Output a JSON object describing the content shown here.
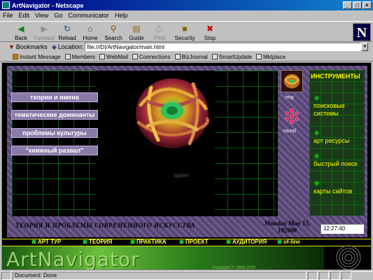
{
  "window": {
    "title": "ArtNavigator - Netscape"
  },
  "menu": [
    "File",
    "Edit",
    "View",
    "Go",
    "Communicator",
    "Help"
  ],
  "toolbar": [
    {
      "label": "Back",
      "icon": "back-arrow-icon",
      "glyph": "◀",
      "enabled": true
    },
    {
      "label": "Forward",
      "icon": "forward-arrow-icon",
      "glyph": "▶",
      "enabled": false
    },
    {
      "label": "Reload",
      "icon": "reload-icon",
      "glyph": "↻",
      "enabled": true
    },
    {
      "label": "Home",
      "icon": "home-icon",
      "glyph": "⌂",
      "enabled": true
    },
    {
      "label": "Search",
      "icon": "search-icon",
      "glyph": "⚲",
      "enabled": true
    },
    {
      "label": "Guide",
      "icon": "guide-icon",
      "glyph": "▤",
      "enabled": true
    },
    {
      "label": "Print",
      "icon": "print-icon",
      "glyph": "⎙",
      "enabled": false
    },
    {
      "label": "Security",
      "icon": "lock-icon",
      "glyph": "🔒",
      "enabled": true
    },
    {
      "label": "Stop",
      "icon": "stop-icon",
      "glyph": "✖",
      "enabled": true
    }
  ],
  "location": {
    "bookmarks_label": "Bookmarks",
    "location_label": "Location:",
    "url": "file:///D|/ArtNavigator/main.html"
  },
  "personal_toolbar": [
    "Instant Message",
    "Members",
    "WebMail",
    "Connections",
    "BizJournal",
    "SmartUpdate",
    "Mktplace"
  ],
  "page": {
    "nav_buttons": [
      "теории и имена",
      "тематические доминанты",
      "проблемы культуры",
      "\"книжный развал\""
    ],
    "applet_label": "applet",
    "img_label": "img",
    "round_label": "round",
    "tools_title": "ИНСТРУМЕНТЫ",
    "tools": [
      "поисковые системы",
      "арт ресурсы",
      "быстрый поиск",
      "карты сайтов"
    ],
    "footer_title": "ТЕОРИЯ И ПРОБЛЕМЫ СОВРЕМЕННОГО ИСКУССТВА",
    "date_line1": "Monday May 15,",
    "date_line2": "192000",
    "clock": "12:27:40",
    "banner_nav": [
      "АРТ ТУР",
      "ТЕОРИЯ",
      "ПРАКТИКА",
      "ПРОЕКТ",
      "АУДИТОРИЯ",
      "of-line"
    ],
    "logo_text": "ArtNavigator",
    "copyright": "Copyright © 1999-2000"
  },
  "status": {
    "text": "Document: Done"
  },
  "colors": {
    "title_bar": "#000080",
    "grid": "#0a5a0a",
    "tools_text": "#ffff00",
    "tools_star": "#20ff20",
    "nav_button": "#8a7aa8"
  }
}
